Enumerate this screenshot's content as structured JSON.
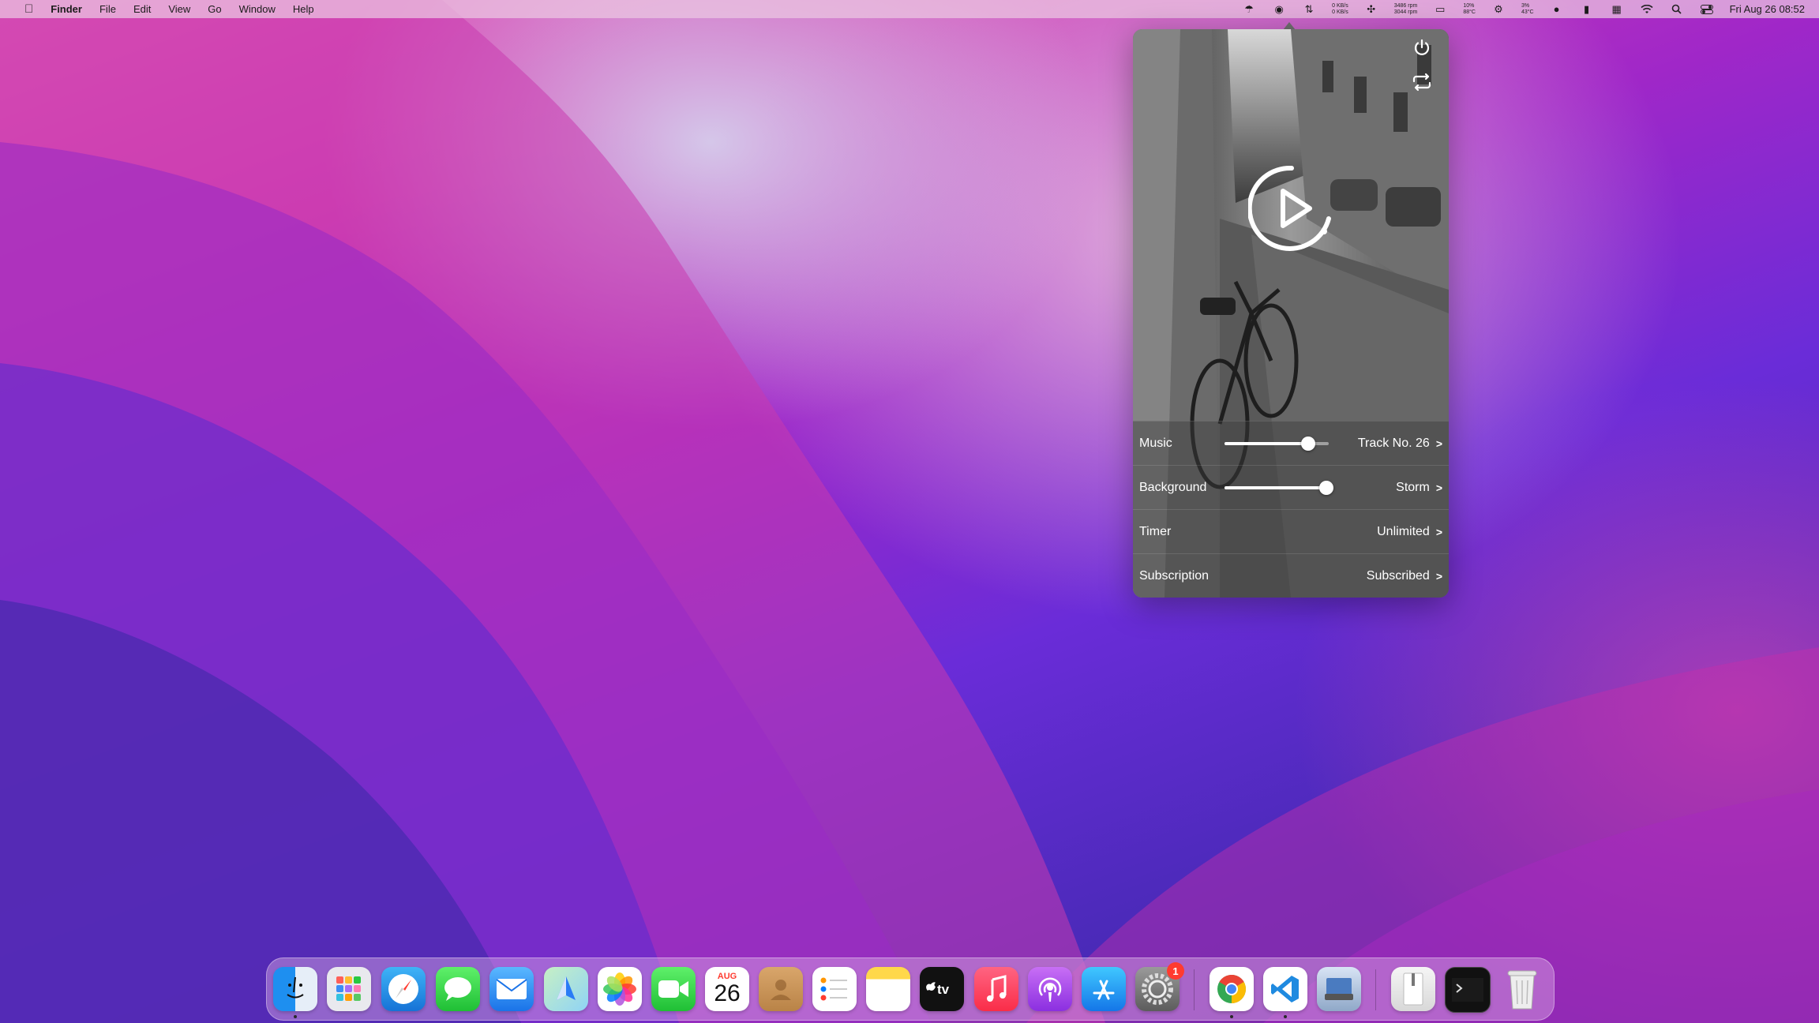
{
  "menubar": {
    "app_name": "Finder",
    "menus": [
      "File",
      "Edit",
      "View",
      "Go",
      "Window",
      "Help"
    ],
    "net_up": "0 KB/s",
    "net_down": "0 KB/s",
    "fan1": "3486 rpm",
    "fan2": "3044 rpm",
    "cpu_temp_top": "10%",
    "cpu_temp_bottom": "88°C",
    "gpu_top": "3%",
    "gpu_bottom": "43°C",
    "datetime": "Fri Aug 26  08:52"
  },
  "popover": {
    "rows": [
      {
        "label": "Music",
        "value": "Track No. 26",
        "slider_level": 0.8
      },
      {
        "label": "Background",
        "value": "Storm",
        "slider_level": 0.98
      },
      {
        "label": "Timer",
        "value": "Unlimited"
      },
      {
        "label": "Subscription",
        "value": "Subscribed"
      }
    ]
  },
  "dock": {
    "calendar_month": "AUG",
    "calendar_day": "26",
    "settings_badge": "1",
    "apps": [
      "Finder",
      "Launchpad",
      "Safari",
      "Messages",
      "Mail",
      "Maps",
      "Photos",
      "FaceTime",
      "Calendar",
      "Contacts",
      "Reminders",
      "Notes",
      "Apple TV",
      "Music",
      "Podcasts",
      "App Store",
      "System Preferences",
      "Google Chrome",
      "Visual Studio Code",
      "Preview",
      "Archive",
      "Terminal",
      "Trash"
    ]
  },
  "colors": {
    "menubar_bg": "#ecc8e2",
    "accent": "#ff3b30"
  }
}
